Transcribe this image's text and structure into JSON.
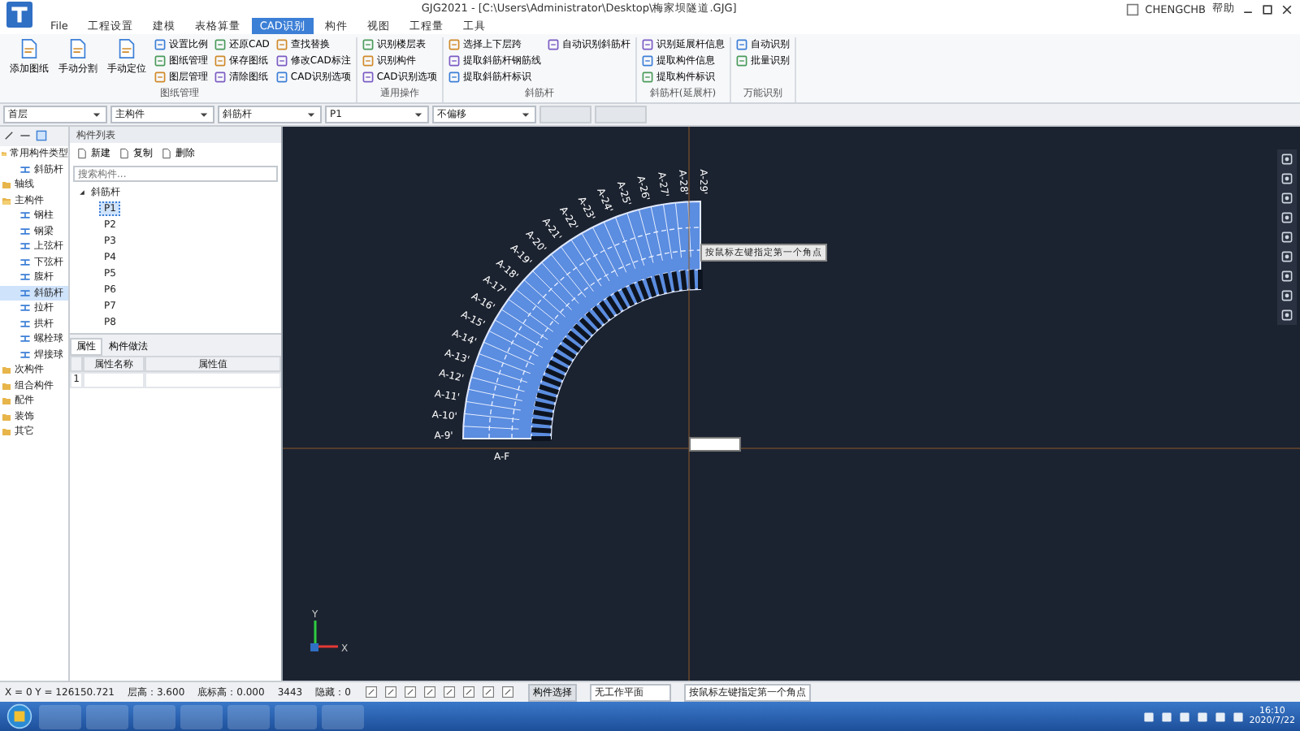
{
  "window": {
    "title": "GJG2021 - [C:\\Users\\Administrator\\Desktop\\梅家坝隧道.GJG]",
    "user": "CHENGCHB",
    "help": "帮助"
  },
  "ribbon_tabs": [
    {
      "label": "File",
      "selected": false
    },
    {
      "label": "工程设置",
      "selected": false
    },
    {
      "label": "建模",
      "selected": false
    },
    {
      "label": "表格算量",
      "selected": false
    },
    {
      "label": "CAD识别",
      "selected": true
    },
    {
      "label": "构件",
      "selected": false
    },
    {
      "label": "视图",
      "selected": false
    },
    {
      "label": "工程量",
      "selected": false
    },
    {
      "label": "工具",
      "selected": false
    }
  ],
  "ribbon_groups": [
    {
      "title": "图纸管理",
      "large_buttons": [
        "添加图纸",
        "手动分割",
        "手动定位"
      ],
      "columns": [
        [
          "设置比例",
          "图纸管理",
          "图层管理"
        ],
        [
          "还原CAD",
          "保存图纸",
          "清除图纸"
        ],
        [
          "查找替换",
          "修改CAD标注",
          "CAD识别选项"
        ]
      ]
    },
    {
      "title": "通用操作",
      "columns": [
        [
          "识别楼层表",
          "识别构件",
          "CAD识别选项"
        ]
      ]
    },
    {
      "title": "斜筋杆",
      "columns": [
        [
          "选择上下层跨",
          "提取斜筋杆钢筋线",
          "提取斜筋杆标识"
        ],
        [
          "自动识别斜筋杆"
        ]
      ]
    },
    {
      "title": "斜筋杆(延展杆)",
      "columns": [
        [
          "识别延展杆信息",
          "提取构件信息",
          "提取构件标识"
        ]
      ]
    },
    {
      "title": "万能识别",
      "columns": [
        [
          "自动识别",
          "批量识别"
        ]
      ]
    }
  ],
  "selectors": [
    "首层",
    "主构件",
    "斜筋杆",
    "P1",
    "不偏移"
  ],
  "tree": [
    {
      "label": "常用构件类型",
      "expanded": true,
      "children": [
        {
          "label": "斜筋杆",
          "selected": false
        }
      ]
    },
    {
      "label": "轴线",
      "expanded": false
    },
    {
      "label": "主构件",
      "expanded": true,
      "children": [
        {
          "label": "钢柱",
          "selected": false
        },
        {
          "label": "钢梁",
          "selected": false
        },
        {
          "label": "上弦杆",
          "selected": false
        },
        {
          "label": "下弦杆",
          "selected": false
        },
        {
          "label": "腹杆",
          "selected": false
        },
        {
          "label": "斜筋杆",
          "selected": true
        },
        {
          "label": "拉杆",
          "selected": false
        },
        {
          "label": "拱杆",
          "selected": false
        },
        {
          "label": "螺栓球",
          "selected": false
        },
        {
          "label": "焊接球",
          "selected": false
        }
      ]
    },
    {
      "label": "次构件",
      "expanded": false
    },
    {
      "label": "组合构件",
      "expanded": false
    },
    {
      "label": "配件",
      "expanded": false
    },
    {
      "label": "装饰",
      "expanded": false
    },
    {
      "label": "其它",
      "expanded": false
    }
  ],
  "component_list": {
    "title": "构件列表",
    "buttons": [
      "新建",
      "复制",
      "删除"
    ],
    "search": {
      "placeholder": "搜索构件..."
    },
    "root": {
      "label": "斜筋杆",
      "expanded": true
    },
    "items": [
      {
        "label": "P1",
        "selected": true
      },
      {
        "label": "P2",
        "selected": false
      },
      {
        "label": "P3",
        "selected": false
      },
      {
        "label": "P4",
        "selected": false
      },
      {
        "label": "P5",
        "selected": false
      },
      {
        "label": "P6",
        "selected": false
      },
      {
        "label": "P7",
        "selected": false
      },
      {
        "label": "P8",
        "selected": false
      }
    ]
  },
  "properties": {
    "tabs": [
      {
        "label": "属性",
        "selected": true
      },
      {
        "label": "构件做法",
        "selected": false
      }
    ],
    "columns": [
      "属性名称",
      "属性值"
    ],
    "rows": [
      {
        "index": "1"
      }
    ]
  },
  "canvas": {
    "arc_labels": [
      "A-9'",
      "A-10'",
      "A-11'",
      "A-12'",
      "A-13'",
      "A-14'",
      "A-15'",
      "A-16'",
      "A-17'",
      "A-18'",
      "A-19'",
      "A-20'",
      "A-21'",
      "A-22'",
      "A-23'",
      "A-24'",
      "A-25'",
      "A-26'",
      "A-27'",
      "A-28'",
      "A-29'"
    ],
    "bottom_label": "A-F",
    "tooltip": "按鼠标左键指定第一个角点",
    "axis": {
      "x": "X",
      "y": "Y"
    }
  },
  "status_bar": {
    "coords": "X = 0 Y = 126150.721",
    "floor_height": "层高：3.600",
    "base_elevation": "底标高：0.000",
    "count": "3443",
    "hidden": "隐藏：0",
    "select_button": "构件选择",
    "plane": "无工作平面",
    "hint": "按鼠标左键指定第一个角点"
  },
  "taskbar": {
    "time": "16:10",
    "date": "2020/7/22"
  }
}
